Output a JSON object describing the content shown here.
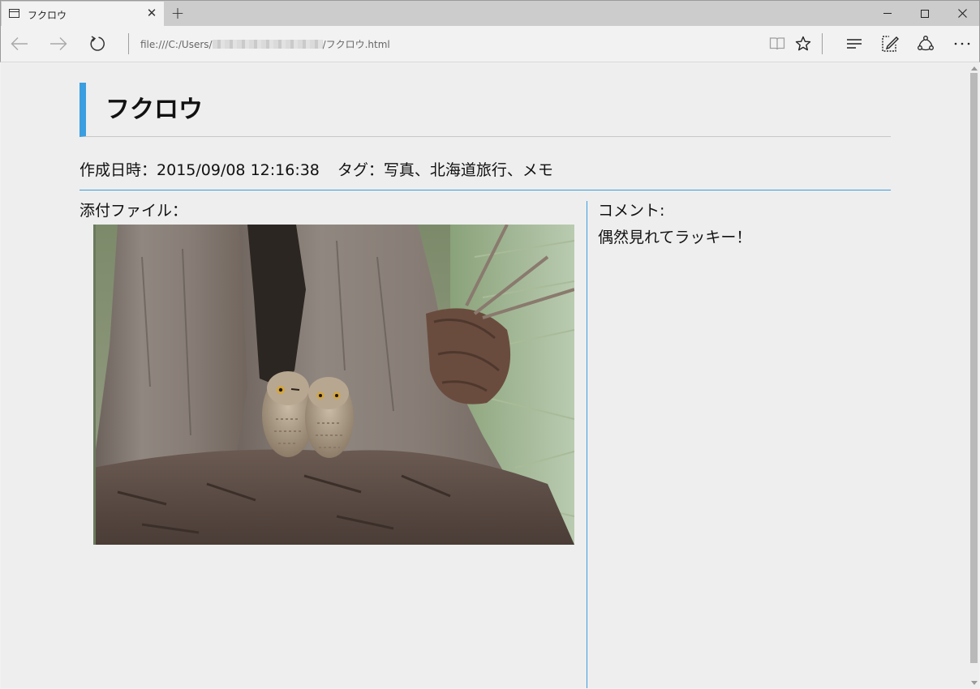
{
  "browser": {
    "tab_title": "フクロウ",
    "tab_close": "✕",
    "new_tab": "+",
    "url_prefix": "file:///C:/Users/",
    "url_suffix": "/フクロウ.html"
  },
  "page": {
    "title": "フクロウ",
    "created_label": "作成日時：",
    "created_value": "2015/09/08 12:16:38",
    "tag_label": "タグ：",
    "tag_value": "写真、北海道旅行、メモ",
    "attachment_label": "添付ファイル：",
    "comment_label": "コメント:",
    "comment_text": "偶然見れてラッキー！"
  },
  "colors": {
    "accent": "#3a9ee0",
    "page_background": "#eeeeee"
  },
  "icons": [
    "window-icon",
    "close-icon",
    "plus-icon",
    "back-icon",
    "forward-icon",
    "refresh-icon",
    "reading-view-icon",
    "star-icon",
    "hub-icon",
    "web-note-icon",
    "share-icon",
    "more-icon"
  ]
}
